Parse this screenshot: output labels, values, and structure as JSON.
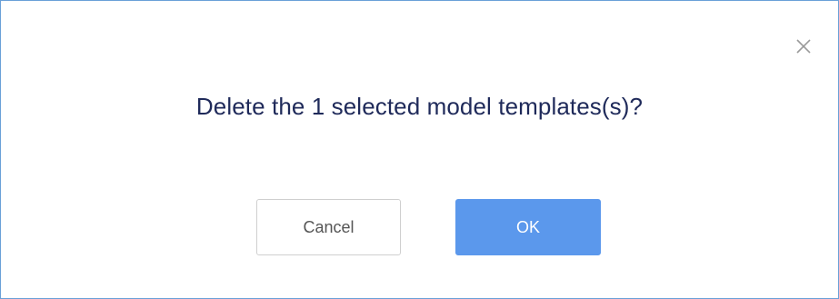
{
  "dialog": {
    "message": "Delete the 1 selected model templates(s)?",
    "close_icon": "close-icon",
    "cancel_label": "Cancel",
    "ok_label": "OK"
  },
  "colors": {
    "primary": "#5b98ec",
    "text": "#1f2a5a",
    "border": "#6aa0d8"
  }
}
